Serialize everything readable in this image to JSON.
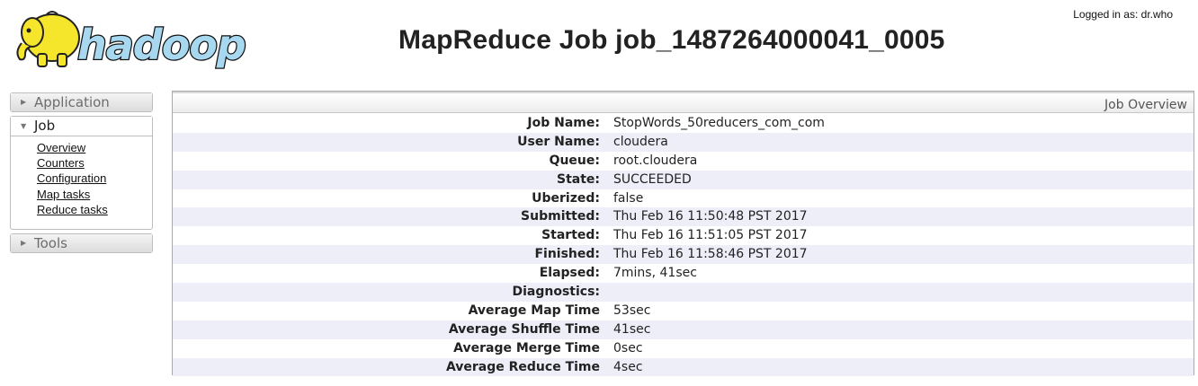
{
  "header": {
    "logged_in": "Logged in as: dr.who",
    "title": "MapReduce Job job_1487264000041_0005",
    "logo_text": "hadoop"
  },
  "nav": {
    "application": "Application",
    "job": "Job",
    "job_links": [
      "Overview",
      "Counters",
      "Configuration",
      "Map tasks",
      "Reduce tasks"
    ],
    "tools": "Tools"
  },
  "overview": {
    "title": "Job Overview",
    "rows": [
      {
        "label": "Job Name:",
        "value": "StopWords_50reducers_com_com"
      },
      {
        "label": "User Name:",
        "value": "cloudera"
      },
      {
        "label": "Queue:",
        "value": "root.cloudera"
      },
      {
        "label": "State:",
        "value": "SUCCEEDED"
      },
      {
        "label": "Uberized:",
        "value": "false"
      },
      {
        "label": "Submitted:",
        "value": "Thu Feb 16 11:50:48 PST 2017"
      },
      {
        "label": "Started:",
        "value": "Thu Feb 16 11:51:05 PST 2017"
      },
      {
        "label": "Finished:",
        "value": "Thu Feb 16 11:58:46 PST 2017"
      },
      {
        "label": "Elapsed:",
        "value": "7mins, 41sec"
      },
      {
        "label": "Diagnostics:",
        "value": ""
      },
      {
        "label": "Average Map Time",
        "value": "53sec"
      },
      {
        "label": "Average Shuffle Time",
        "value": "41sec"
      },
      {
        "label": "Average Merge Time",
        "value": "0sec"
      },
      {
        "label": "Average Reduce Time",
        "value": "4sec"
      }
    ]
  },
  "icons": {
    "logo": "hadoop-elephant-logo",
    "collapsed": "triangle-right-icon",
    "expanded": "triangle-down-icon"
  },
  "colors": {
    "row_alt": "#eeeef9",
    "logo_text_fill": "#a8d8f0",
    "elephant": "#f5e62b"
  }
}
